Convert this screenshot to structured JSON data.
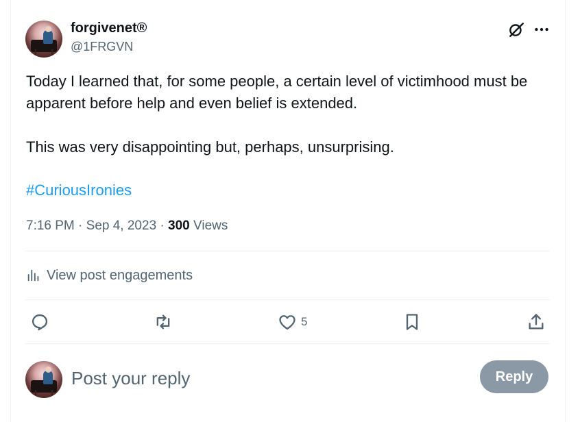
{
  "author": {
    "display_name": "forgivenet®",
    "handle": "@1FRGVN"
  },
  "tweet": {
    "paragraphs": [
      "Today I learned that, for some people, a certain level of victimhood must be apparent before help and even belief is extended.",
      "This was very disappointing but, perhaps, unsurprising."
    ],
    "hashtag": "#CuriousIronies",
    "time": "7:16 PM",
    "date": "Sep 4, 2023",
    "separator": " · ",
    "views_count": "300",
    "views_label": "Views"
  },
  "engagements": {
    "label": "View post engagements"
  },
  "actions": {
    "like_count": "5"
  },
  "reply_box": {
    "placeholder": "Post your reply",
    "button_label": "Reply"
  },
  "colors": {
    "accent": "#1d9bf0",
    "secondary_text": "#536471",
    "reply_button_disabled": "#8b98a5"
  },
  "icons": {
    "header": [
      "grok-icon",
      "more-icon"
    ],
    "actions": [
      "reply-icon",
      "repost-icon",
      "like-icon",
      "bookmark-icon",
      "share-icon"
    ]
  }
}
